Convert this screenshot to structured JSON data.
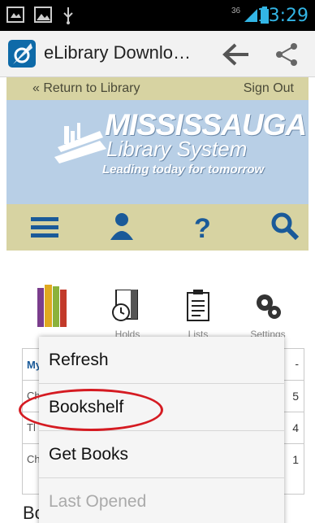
{
  "status_bar": {
    "time": "13:29",
    "signal_label": "36",
    "icons": [
      "notification-icon",
      "image-icon",
      "usb-icon",
      "signal-icon",
      "battery-icon"
    ]
  },
  "app_bar": {
    "title": "eLibrary Downlo…",
    "back_icon": "back-arrow-icon",
    "share_icon": "share-icon"
  },
  "web": {
    "nav": {
      "return_label": "« Return to Library",
      "signout_label": "Sign Out"
    },
    "banner": {
      "title": "MISSISSAUGA",
      "subtitle": "Library System",
      "tagline": "Leading today for tomorrow"
    },
    "iconbar": [
      "menu-icon",
      "user-icon",
      "help-icon",
      "search-icon"
    ],
    "tools": [
      {
        "label": "",
        "icon": "books-icon"
      },
      {
        "label": "Holds",
        "icon": "holds-icon"
      },
      {
        "label": "Lists",
        "icon": "lists-icon"
      },
      {
        "label": "Settings",
        "icon": "settings-icon"
      }
    ],
    "table": {
      "header_left": "My",
      "header_right": "-",
      "rows": [
        {
          "left": "Ch",
          "right": "5"
        },
        {
          "left": "Tl",
          "right": "4"
        },
        {
          "left": "Ch",
          "right": "1"
        }
      ]
    },
    "bottom_heading": "Bo"
  },
  "menu": {
    "items": [
      {
        "label": "Refresh",
        "enabled": true
      },
      {
        "label": "Bookshelf",
        "enabled": true
      },
      {
        "label": "Get Books",
        "enabled": true
      },
      {
        "label": "Last Opened",
        "enabled": false
      }
    ]
  },
  "colors": {
    "accent": "#33b5e5",
    "highlight_circle": "#d51b22",
    "tan": "#d7d3a2",
    "banner": "#b8cfe6"
  }
}
